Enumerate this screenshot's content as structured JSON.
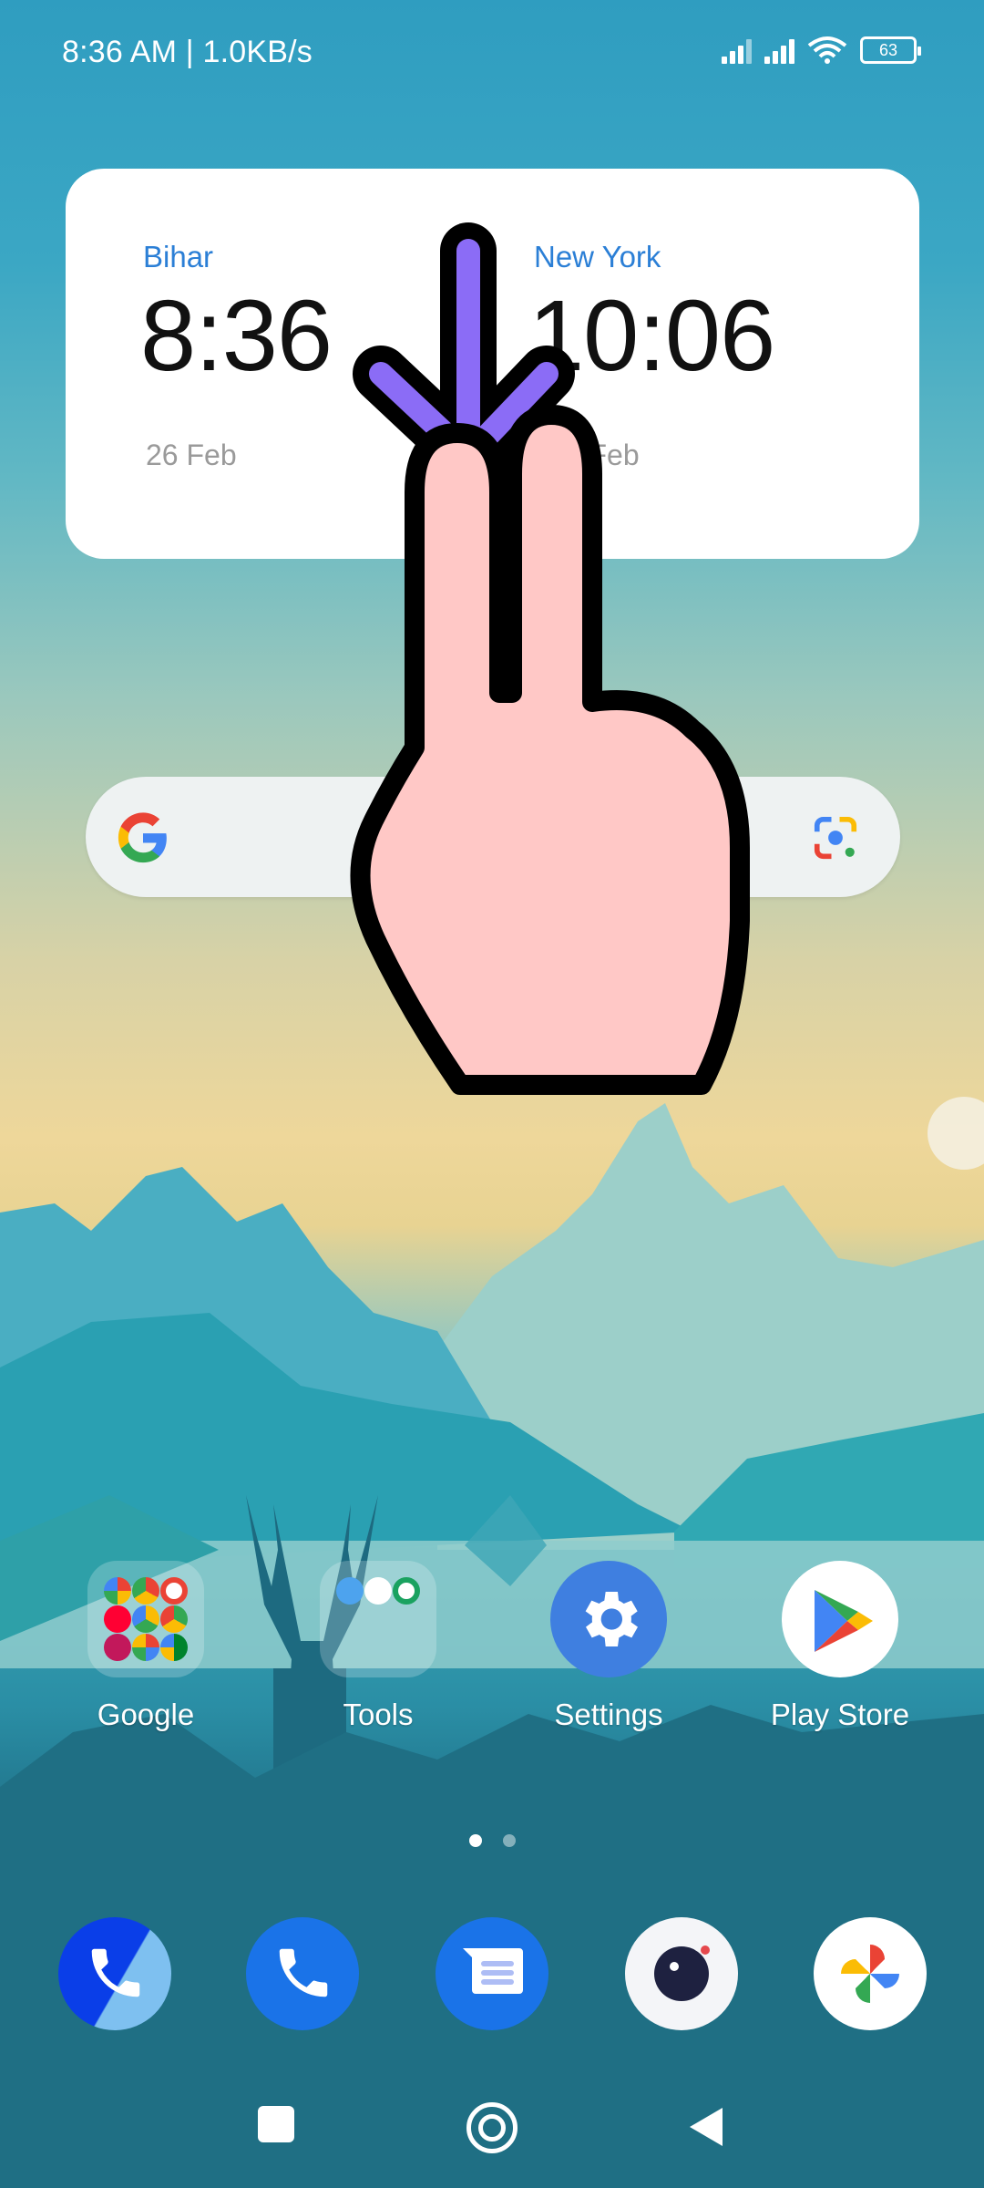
{
  "status_bar": {
    "time_speed": "8:36 AM | 1.0KB/s",
    "battery": "63",
    "icons": [
      "signal-sim1-icon",
      "signal-sim2-icon",
      "wifi-icon",
      "battery-icon"
    ]
  },
  "clock_widget": {
    "clocks": [
      {
        "city": "Bihar",
        "time": "8:36",
        "date": "26 Feb"
      },
      {
        "city": "New York",
        "time": "10:06",
        "date": "26 Feb"
      }
    ]
  },
  "search_widget": {
    "left_icon": "google-g-icon",
    "right_icon": "google-lens-icon"
  },
  "home_apps": [
    {
      "label": "Google",
      "icon": "google-folder-icon"
    },
    {
      "label": "Tools",
      "icon": "tools-folder-icon"
    },
    {
      "label": "Settings",
      "icon": "settings-gear-icon"
    },
    {
      "label": "Play Store",
      "icon": "play-store-icon"
    }
  ],
  "page_indicator": {
    "pages": 2,
    "current": 1
  },
  "dock": [
    {
      "name": "Truecaller",
      "icon": "truecaller-phone-icon"
    },
    {
      "name": "Phone",
      "icon": "phone-icon"
    },
    {
      "name": "Messages",
      "icon": "messages-icon"
    },
    {
      "name": "Camera",
      "icon": "camera-icon"
    },
    {
      "name": "Photos",
      "icon": "photos-pinwheel-icon"
    }
  ],
  "nav_bar": [
    "recents-button",
    "home-button",
    "back-button"
  ],
  "overlay": {
    "gesture": "two-finger swipe down",
    "arrow_color": "#8b6cf6",
    "hand_color": "#ffc8c6"
  },
  "colors": {
    "accent_blue": "#2b7fd6",
    "settings_blue": "#3f7fe0"
  }
}
